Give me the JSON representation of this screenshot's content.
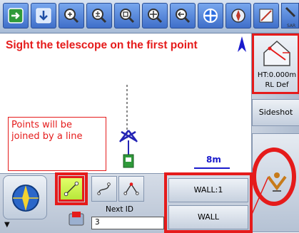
{
  "toolbar": {
    "buttons": [
      {
        "name": "exit-icon"
      },
      {
        "name": "download-icon"
      },
      {
        "name": "zoom-in-icon"
      },
      {
        "name": "zoom-extents-icon"
      },
      {
        "name": "zoom-window-icon"
      },
      {
        "name": "pan-icon"
      },
      {
        "name": "back-icon"
      },
      {
        "name": "crosshair-icon"
      }
    ],
    "trailing_label": "SAR"
  },
  "map": {
    "instruction": "Sight the telescope on the first point",
    "callout": "Points will be joined by a line",
    "scale_label": "8m",
    "north_arrow": "north-arrow-icon"
  },
  "right_panel": {
    "ht_value": "HT:0.000m",
    "rl_label": "RL Def",
    "sideshot_label": "Sideshot"
  },
  "bottom_panel": {
    "next_id_label": "Next ID",
    "next_id_value": "3",
    "wall_code": "WALL:1",
    "wall_label": "WALL"
  },
  "colors": {
    "annotation_red": "#e51b1b",
    "toolbar_blue": "#3f6fc9",
    "active_mode": "#c8f04a",
    "scale_blue": "#1a1acc"
  }
}
